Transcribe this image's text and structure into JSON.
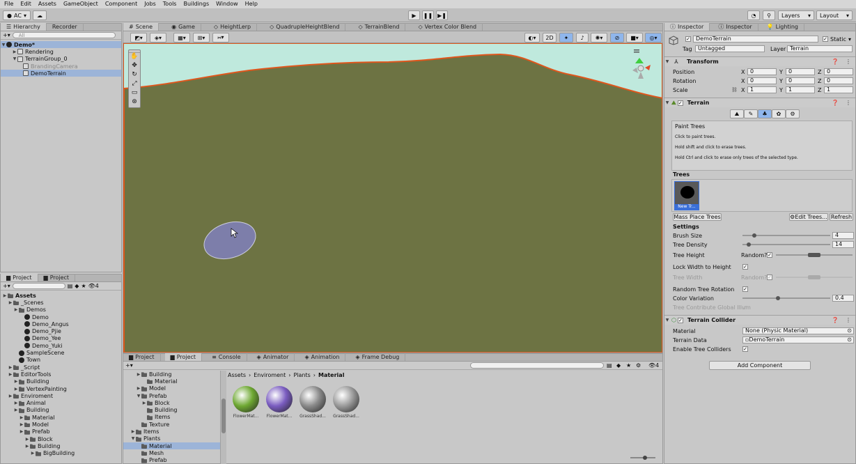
{
  "menubar": {
    "items": [
      "File",
      "Edit",
      "Assets",
      "GameObject",
      "Component",
      "Jobs",
      "Tools",
      "Buildings",
      "Window",
      "Help"
    ]
  },
  "toolbar": {
    "account": "AC",
    "layers": "Layers",
    "layout": "Layout"
  },
  "hierarchy": {
    "tabs": [
      "Hierarchy",
      "Recorder"
    ],
    "search_placeholder": "All",
    "scene": "Demo*",
    "items": [
      {
        "label": "Rendering",
        "indent": 2
      },
      {
        "label": "TerrainGroup_0",
        "indent": 2
      },
      {
        "label": "BrandingCamera",
        "indent": 3
      },
      {
        "label": "DemoTerrain",
        "indent": 3
      }
    ]
  },
  "project_left": {
    "tabs": [
      "Project",
      "Project"
    ],
    "count": "4",
    "items": [
      {
        "label": "Assets",
        "indent": 0,
        "bold": true
      },
      {
        "label": "_Scenes",
        "indent": 1
      },
      {
        "label": "Demos",
        "indent": 2
      },
      {
        "label": "Demo",
        "indent": 3
      },
      {
        "label": "Demo_Angus",
        "indent": 3
      },
      {
        "label": "Demo_Pjie",
        "indent": 3
      },
      {
        "label": "Demo_Yee",
        "indent": 3
      },
      {
        "label": "Demo_Yuki",
        "indent": 3
      },
      {
        "label": "SampleScene",
        "indent": 2
      },
      {
        "label": "Town",
        "indent": 2
      },
      {
        "label": "_Script",
        "indent": 1
      },
      {
        "label": "EditorTools",
        "indent": 1
      },
      {
        "label": "Building",
        "indent": 2
      },
      {
        "label": "VertexPainting",
        "indent": 2
      },
      {
        "label": "Enviroment",
        "indent": 1
      },
      {
        "label": "Animal",
        "indent": 2
      },
      {
        "label": "Building",
        "indent": 2
      },
      {
        "label": "Material",
        "indent": 3
      },
      {
        "label": "Model",
        "indent": 3
      },
      {
        "label": "Prefab",
        "indent": 3
      },
      {
        "label": "Block",
        "indent": 4
      },
      {
        "label": "Building",
        "indent": 4
      },
      {
        "label": "BigBuilding",
        "indent": 5
      }
    ]
  },
  "scene_tabs": [
    "Scene",
    "Game",
    "HeightLerp",
    "QuadrupleHeightBlend",
    "TerrainBlend",
    "Vertex Color Blend"
  ],
  "scene_toolbar": {
    "mode_2d": "2D"
  },
  "bottom": {
    "tabs": [
      "Project",
      "Project",
      "Console",
      "Animator",
      "Animation",
      "Frame Debug"
    ],
    "count": "4",
    "breadcrumb": [
      "Assets",
      "Enviroment",
      "Plants",
      "Material"
    ],
    "tree": [
      {
        "label": "Building",
        "indent": 3
      },
      {
        "label": "Material",
        "indent": 4
      },
      {
        "label": "Model",
        "indent": 3
      },
      {
        "label": "Prefab",
        "indent": 3
      },
      {
        "label": "Block",
        "indent": 4
      },
      {
        "label": "Building",
        "indent": 4
      },
      {
        "label": "Items",
        "indent": 4
      },
      {
        "label": "Texture",
        "indent": 3
      },
      {
        "label": "Items",
        "indent": 2
      },
      {
        "label": "Plants",
        "indent": 2
      },
      {
        "label": "Material",
        "indent": 3
      },
      {
        "label": "Mesh",
        "indent": 3
      },
      {
        "label": "Prefab",
        "indent": 3
      }
    ],
    "assets": [
      {
        "label": "FlowerMat...",
        "color": "#6ea832"
      },
      {
        "label": "FlowerMat...",
        "color": "#7a5cc0"
      },
      {
        "label": "GrassShad...",
        "color": "#8a8a8a"
      },
      {
        "label": "GrassShad...",
        "color": "#9a9a9a"
      }
    ]
  },
  "inspector": {
    "tabs": [
      "Inspector",
      "Inspector",
      "Lighting"
    ],
    "object_name": "DemoTerrain",
    "static_label": "Static",
    "tag_label": "Tag",
    "tag_value": "Untagged",
    "layer_label": "Layer",
    "layer_value": "Terrain",
    "transform": {
      "title": "Transform",
      "rows": [
        {
          "label": "Position",
          "x": "0",
          "y": "0",
          "z": "0"
        },
        {
          "label": "Rotation",
          "x": "0",
          "y": "0",
          "z": "0"
        },
        {
          "label": "Scale",
          "x": "1",
          "y": "1",
          "z": "1"
        }
      ]
    },
    "terrain": {
      "title": "Terrain",
      "paint_title": "Paint Trees",
      "help": [
        "Click to paint trees.",
        "Hold shift and click to erase trees.",
        "Hold Ctrl and click to erase only trees of the selected type."
      ],
      "trees_label": "Trees",
      "tree_thumb": "New Tr...",
      "mass_place": "Mass Place Trees",
      "edit_trees": "Edit Trees...",
      "refresh": "Refresh",
      "settings_label": "Settings",
      "brush_size_label": "Brush Size",
      "brush_size": "4",
      "brush_size_frac": 0.12,
      "tree_density_label": "Tree Density",
      "tree_density": "14",
      "tree_density_frac": 0.05,
      "tree_height_label": "Tree Height",
      "random_label": "Random?",
      "lock_label": "Lock Width to Height",
      "tree_width_label": "Tree Width",
      "random_rot_label": "Random Tree Rotation",
      "color_var_label": "Color Variation",
      "color_var": "0.4",
      "color_var_frac": 0.4,
      "global_illum_label": "Tree Contribute Global Illum"
    },
    "collider": {
      "title": "Terrain Collider",
      "material_label": "Material",
      "material_value": "None (Physic Material)",
      "data_label": "Terrain Data",
      "data_value": "DemoTerrain",
      "enable_label": "Enable Tree Colliders"
    },
    "add_component": "Add Component"
  }
}
